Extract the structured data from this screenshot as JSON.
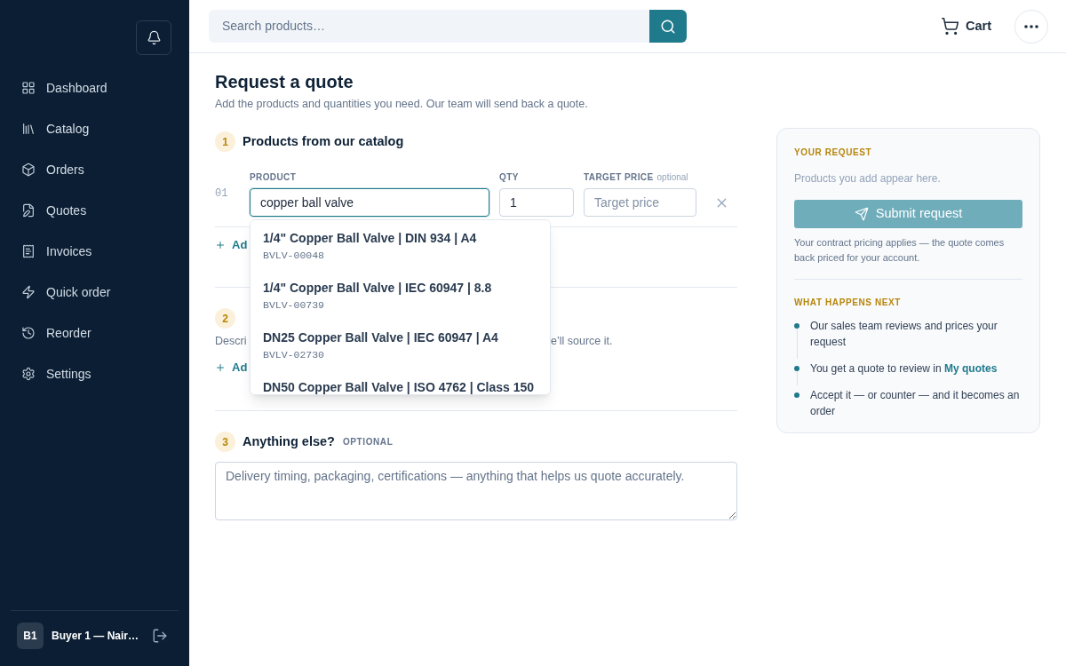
{
  "sidebar": {
    "nav": [
      {
        "label": "Dashboard",
        "selected": false
      },
      {
        "label": "Catalog",
        "selected": false
      },
      {
        "label": "Orders",
        "selected": false
      },
      {
        "label": "Quotes",
        "selected": false
      },
      {
        "label": "Invoices",
        "selected": false
      },
      {
        "label": "Quick order",
        "selected": false
      },
      {
        "label": "Reorder",
        "selected": false
      },
      {
        "label": "Settings",
        "selected": false
      }
    ],
    "user": {
      "initials": "B1",
      "name": "Buyer 1 — Nair…"
    }
  },
  "topbar": {
    "search": {
      "placeholder": "Search products…"
    },
    "cart": {
      "label": "Cart"
    }
  },
  "page": {
    "title": "Request a quote",
    "subtitle": "Add the products and quantities you need. Our team will send back a quote."
  },
  "catalog": {
    "number": "1",
    "title": "Products from our catalog",
    "columns": [
      {
        "label": "PRODUCT"
      },
      {
        "label": "QTY"
      },
      {
        "label": "TARGET PRICE",
        "hint": "optional"
      }
    ],
    "rows": [
      {
        "index": "01",
        "product": {
          "value": "copper ball valve",
          "focused": true
        },
        "qty": {
          "value": "1"
        },
        "target_price": {
          "placeholder": "Target price"
        }
      }
    ],
    "suggestions": [
      {
        "name": "1/4\" Copper Ball Valve | DIN 934 | A4",
        "code": "BVLV-00048",
        "selected": false
      },
      {
        "name": "1/4\" Copper Ball Valve | IEC 60947 | 8.8",
        "code": "BVLV-00739",
        "selected": false
      },
      {
        "name": "DN25 Copper Ball Valve | IEC 60947 | A4",
        "code": "BVLV-02730",
        "selected": false
      },
      {
        "name": "DN50 Copper Ball Valve | ISO 4762 | Class 150",
        "selected": false
      }
    ],
    "add_link": "Ad"
  },
  "custom": {
    "number": "2",
    "description_start": "Descri",
    "description_end": "e’ll source it.",
    "add_link": "Ad"
  },
  "notes": {
    "number": "3",
    "title": "Anything else?",
    "tag": "OPTIONAL",
    "placeholder": "Delivery timing, packaging, certifications — anything that helps us quote accurately."
  },
  "summary": {
    "heading": "YOUR REQUEST",
    "empty_text": "Products you add appear here.",
    "submit": {
      "label": "Submit request",
      "disabled": true
    },
    "note": "Your contract pricing applies — the quote comes back priced for your account.",
    "next_heading": "WHAT HAPPENS NEXT",
    "steps": [
      {
        "text": "Our sales team reviews and prices your request"
      },
      {
        "text": "You get a quote to review in ",
        "link": "My quotes"
      },
      {
        "text": "Accept it — or counter — and it becomes an order"
      }
    ]
  }
}
